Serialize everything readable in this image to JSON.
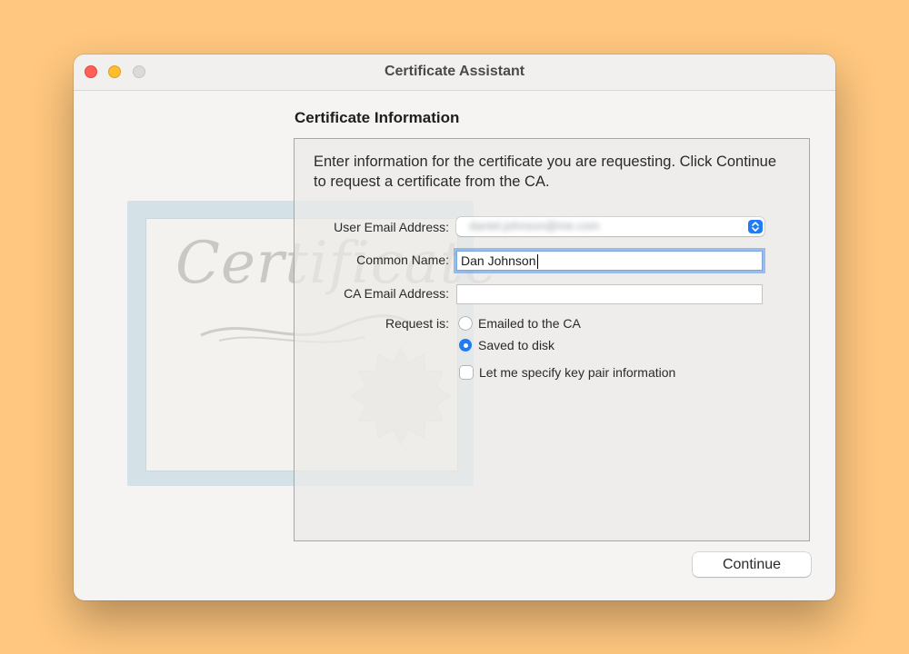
{
  "window": {
    "title": "Certificate Assistant"
  },
  "section": {
    "title": "Certificate Information"
  },
  "intro": {
    "text": "Enter information for the certificate you are requesting. Click Continue to request a certificate from the CA."
  },
  "form": {
    "user_email": {
      "label": "User Email Address:",
      "value": "daniel.johnson@me.com"
    },
    "common_name": {
      "label": "Common Name:",
      "value": "Dan Johnson"
    },
    "ca_email": {
      "label": "CA Email Address:",
      "value": ""
    },
    "request": {
      "label": "Request is:",
      "options": [
        {
          "label": "Emailed to the CA",
          "selected": false
        },
        {
          "label": "Saved to disk",
          "selected": true
        }
      ]
    },
    "key_pair": {
      "label": "Let me specify key pair information",
      "checked": false
    }
  },
  "buttons": {
    "continue": "Continue"
  },
  "watermark": {
    "text": "Certificate"
  }
}
